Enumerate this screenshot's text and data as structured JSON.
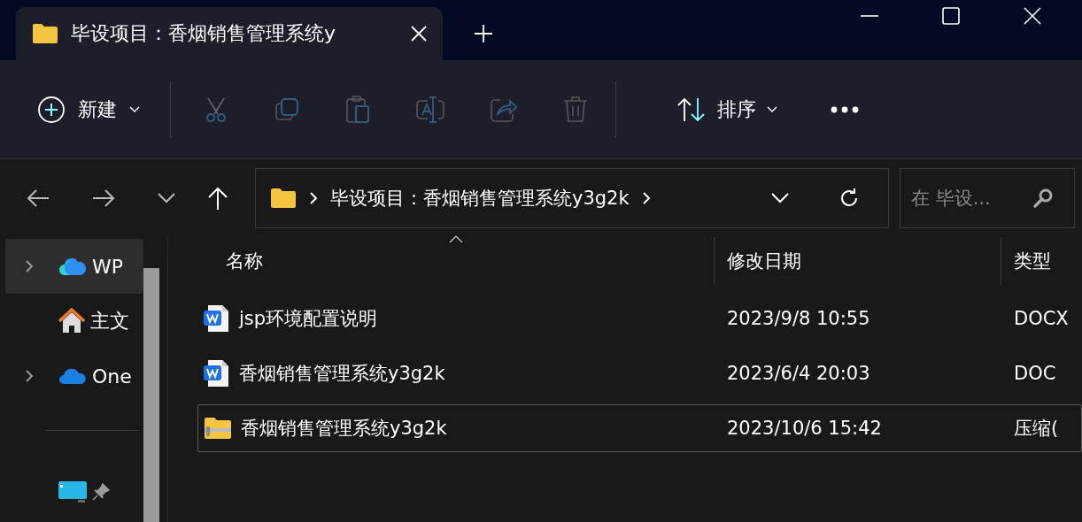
{
  "tab": {
    "title": "毕设项目：香烟销售管理系统y"
  },
  "toolbar": [
    {
      "kind": "new",
      "label": "新建",
      "dropdown": true,
      "disabled": false
    },
    {
      "kind": "cut",
      "disabled": true
    },
    {
      "kind": "copy",
      "disabled": true
    },
    {
      "kind": "paste",
      "disabled": true
    },
    {
      "kind": "rename",
      "disabled": true
    },
    {
      "kind": "share",
      "disabled": true
    },
    {
      "kind": "delete",
      "disabled": true
    },
    {
      "kind": "sort",
      "label": "排序",
      "dropdown": true,
      "disabled": false
    },
    {
      "kind": "more",
      "disabled": false
    }
  ],
  "address": {
    "crumbs": [
      "毕设项目：香烟销售管理系统y3g2k"
    ]
  },
  "search": {
    "placeholder": "在 毕设..."
  },
  "sidebar": {
    "items": [
      {
        "kind": "wps",
        "label": "WP",
        "expandable": true,
        "selected": true,
        "pinned": false
      },
      {
        "kind": "home",
        "label": "主文",
        "expandable": false,
        "selected": false,
        "pinned": false
      },
      {
        "kind": "onedrive",
        "label": "One",
        "expandable": true,
        "selected": false,
        "pinned": false
      },
      {
        "kind": "desktop",
        "expandable": false,
        "selected": false,
        "pinned": true
      }
    ]
  },
  "table": {
    "columns": [
      {
        "label": "名称",
        "sorted": true
      },
      {
        "label": "修改日期",
        "sorted": false
      },
      {
        "label": "类型",
        "sorted": false
      }
    ],
    "rows": [
      {
        "kind": "word",
        "name": "jsp环境配置说明",
        "date": "2023/9/8 10:55",
        "type": "DOCX",
        "selected": false
      },
      {
        "kind": "word",
        "name": "香烟销售管理系统y3g2k",
        "date": "2023/6/4 20:03",
        "type": "DOC",
        "selected": false
      },
      {
        "kind": "zip",
        "name": "香烟销售管理系统y3g2k",
        "date": "2023/10/6 15:42",
        "type": "压缩(",
        "selected": true
      }
    ]
  }
}
